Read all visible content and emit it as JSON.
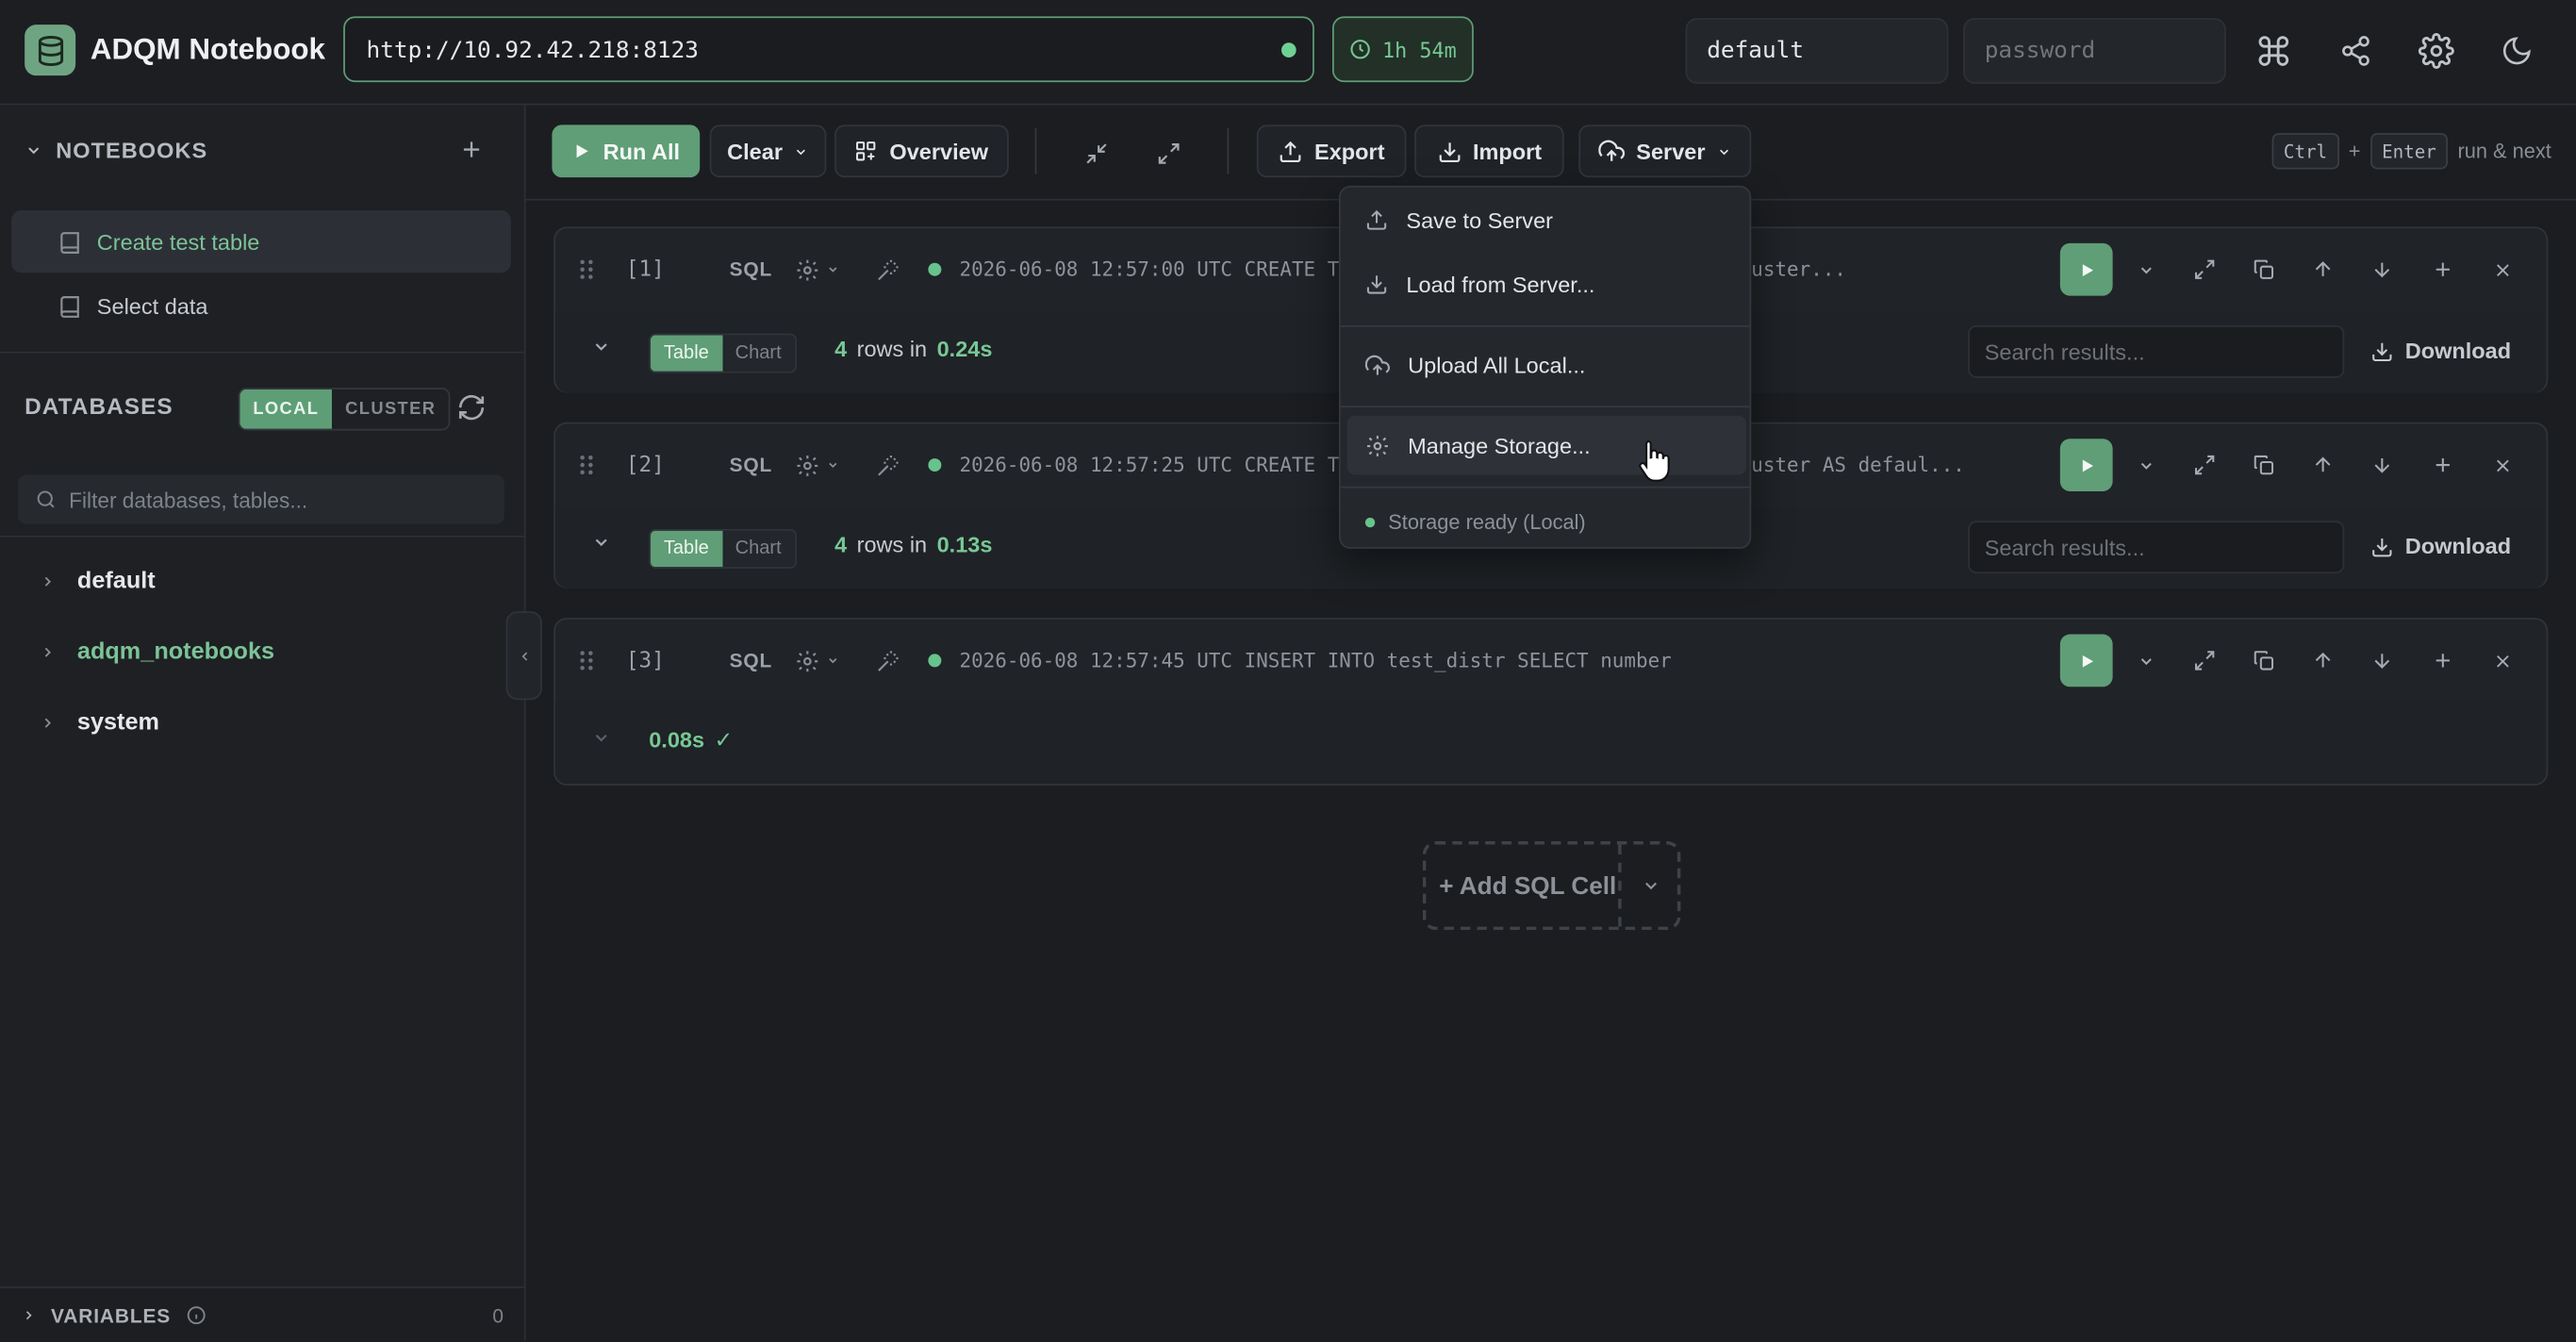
{
  "app": {
    "title": "ADQM Notebook"
  },
  "connection": {
    "url": "http://10.92.42.218:8123",
    "session_timer": "1h 54m",
    "user": "default",
    "password_placeholder": "password"
  },
  "sidebar": {
    "notebooks_header": "NOTEBOOKS",
    "notebooks": [
      {
        "label": "Create test table",
        "active": true
      },
      {
        "label": "Select data",
        "active": false
      }
    ],
    "databases_header": "DATABASES",
    "scope_local": "LOCAL",
    "scope_cluster": "CLUSTER",
    "filter_placeholder": "Filter databases, tables...",
    "databases": [
      {
        "label": "default",
        "color": "#e6e8ea"
      },
      {
        "label": "adqm_notebooks",
        "color": "#7cc397"
      },
      {
        "label": "system",
        "color": "#e6e8ea"
      }
    ],
    "variables_label": "VARIABLES",
    "variables_count": "0"
  },
  "toolbar": {
    "run_all": "Run All",
    "clear": "Clear",
    "overview": "Overview",
    "export": "Export",
    "import": "Import",
    "server": "Server",
    "shortcut_key1": "Ctrl",
    "shortcut_plus": "+",
    "shortcut_key2": "Enter",
    "shortcut_text": "run & next"
  },
  "cells": [
    {
      "index": "[1]",
      "lang": "SQL",
      "text": "2026-06-08 12:57:00 UTC CREATE TAB",
      "text_tail": "uster...",
      "tab_table": "Table",
      "tab_chart": "Chart",
      "rows": "4",
      "rows_in": "rows in",
      "time": "0.24s",
      "search_placeholder": "Search results...",
      "download": "Download"
    },
    {
      "index": "[2]",
      "lang": "SQL",
      "text": "2026-06-08 12:57:25 UTC CREATE TAB",
      "text_tail": "uster AS defaul...",
      "tab_table": "Table",
      "tab_chart": "Chart",
      "rows": "4",
      "rows_in": "rows in",
      "time": "0.13s",
      "search_placeholder": "Search results...",
      "download": "Download"
    },
    {
      "index": "[3]",
      "lang": "SQL",
      "text": "2026-06-08 12:57:45 UTC INSERT INTO test_distr SELECT number",
      "time": "0.08s",
      "check": "✓"
    }
  ],
  "add_cell": {
    "label": "+ Add SQL Cell"
  },
  "server_menu": {
    "items": [
      "Save to Server",
      "Load from Server...",
      "Upload All Local...",
      "Manage Storage..."
    ],
    "status": "Storage ready (Local)"
  }
}
